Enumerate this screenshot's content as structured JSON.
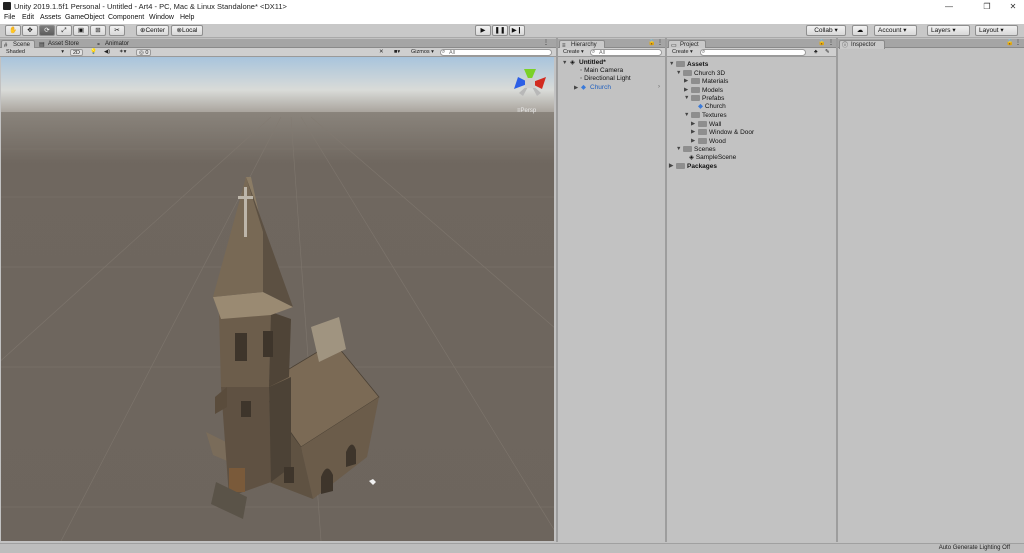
{
  "titlebar": {
    "title": "Unity 2019.1.5f1 Personal - Untitled - Art4 - PC, Mac & Linux Standalone* <DX11>",
    "minimize": "—",
    "maximize": "❐",
    "close": "✕"
  },
  "menu": [
    "File",
    "Edit",
    "Assets",
    "GameObject",
    "Component",
    "Window",
    "Help"
  ],
  "toolbar": {
    "center_label": "Center",
    "local_label": "Local",
    "collab_label": "Collab",
    "account_label": "Account",
    "layers_label": "Layers",
    "layout_label": "Layout"
  },
  "scene_panel": {
    "tabs": [
      "Scene",
      "Asset Store",
      "Animator"
    ],
    "shading": "Shaded",
    "mode_2d": "2D",
    "fx_count": "0",
    "gizmos": "Gizmos",
    "search_placeholder": "All",
    "persp_label": "Persp"
  },
  "hierarchy": {
    "tab": "Hierarchy",
    "create": "Create",
    "search_placeholder": "All",
    "scene": "Untitled*",
    "items": [
      "Main Camera",
      "Directional Light",
      "Church"
    ]
  },
  "project": {
    "tab": "Project",
    "create": "Create",
    "search_placeholder": "",
    "tree": [
      "Assets",
      "Church 3D",
      "Materials",
      "Models",
      "Prefabs",
      "Church",
      "Textures",
      "Wall",
      "Window & Door",
      "Wood",
      "Scenes",
      "SampleScene",
      "Packages"
    ]
  },
  "inspector": {
    "tab": "Inspector"
  },
  "statusbar": {
    "text": "Auto Generate Lighting Off"
  },
  "colors": {
    "sky_top": "#a8c4dc",
    "ground": "#6d655d",
    "selected_text": "#1f5fbf",
    "panel_bg": "#c2c2c2"
  },
  "icons": [
    "unity-logo-icon",
    "hand-tool-icon",
    "move-tool-icon",
    "rotate-tool-icon",
    "scale-tool-icon",
    "rect-tool-icon",
    "transform-tool-icon",
    "custom-tool-icon",
    "play-icon",
    "pause-icon",
    "step-icon",
    "cloud-icon",
    "search-icon",
    "lock-icon",
    "menu-icon",
    "folder-icon",
    "prefab-icon",
    "scene-icon",
    "gizmo-axis-icon"
  ]
}
